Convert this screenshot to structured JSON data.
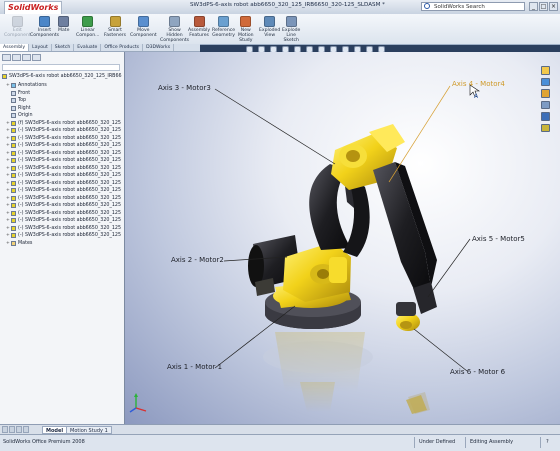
{
  "window": {
    "logo": "SolidWorks",
    "title": "SW3dPS-6-axis robot abb6650_320_125_IRB6650_320-125_SLDASM *",
    "search_placeholder": "SolidWorks Search",
    "controls": [
      "_",
      "□",
      "×"
    ]
  },
  "ribbon": {
    "buttons": [
      {
        "id": "edit-component",
        "label": "Edit\nComponent",
        "color": "#9fa9b8",
        "disabled": true
      },
      {
        "id": "insert-components",
        "label": "Insert\nComponents",
        "color": "#4b86c8"
      },
      {
        "id": "mate",
        "label": "Mate",
        "color": "#6e7fa0"
      },
      {
        "id": "linear-component",
        "label": "Linear\nCompon...",
        "color": "#3e9c4b"
      },
      {
        "id": "smart-fasteners",
        "label": "Smart\nFasteners",
        "color": "#c7a23a"
      },
      {
        "id": "move-component",
        "label": "Move\nComponent",
        "color": "#5a8fcf"
      },
      {
        "id": "show-hidden",
        "label": "Show\nHidden\nComponents",
        "color": "#8fa5c0"
      },
      {
        "id": "assembly-features",
        "label": "Assembly\nFeatures",
        "color": "#b85a3c"
      },
      {
        "id": "reference-geometry",
        "label": "Reference\nGeometry",
        "color": "#6aa0d0"
      },
      {
        "id": "new-motion-study",
        "label": "New\nMotion\nStudy",
        "color": "#d06a3a"
      },
      {
        "id": "exploded-view",
        "label": "Exploded\nView",
        "color": "#5f8ab8"
      },
      {
        "id": "explode-line-sketch",
        "label": "Explode\nLine\nSketch",
        "color": "#7b95b9"
      }
    ]
  },
  "command_tabs": [
    "Assembly",
    "Layout",
    "Sketch",
    "Evaluate",
    "Office Products",
    "D3DWorks"
  ],
  "feature_tree": {
    "root": "SW3dPS-6-axis robot abb6650_320_125_IRB66",
    "items": [
      {
        "label": "Annotations",
        "icon": "ann",
        "expand": "+"
      },
      {
        "label": "Front",
        "icon": "plane",
        "expand": ""
      },
      {
        "label": "Top",
        "icon": "plane",
        "expand": ""
      },
      {
        "label": "Right",
        "icon": "plane",
        "expand": ""
      },
      {
        "label": "Origin",
        "icon": "plane",
        "expand": ""
      },
      {
        "label": "(f) SW3dPS-6-axis robot abb6650_320_125",
        "icon": "part",
        "expand": "+"
      },
      {
        "label": "(-) SW3dPS-6-axis robot abb6650_320_125",
        "icon": "part",
        "expand": "+"
      },
      {
        "label": "(-) SW3dPS-6-axis robot abb6650_320_125",
        "icon": "part",
        "expand": "+"
      },
      {
        "label": "(-) SW3dPS-6-axis robot abb6650_320_125",
        "icon": "part",
        "expand": "+"
      },
      {
        "label": "(-) SW3dPS-6-axis robot abb6650_320_125",
        "icon": "part",
        "expand": "+"
      },
      {
        "label": "(-) SW3dPS-6-axis robot abb6650_320_125",
        "icon": "part",
        "expand": "+"
      },
      {
        "label": "(-) SW3dPS-6-axis robot abb6650_320_125",
        "icon": "part",
        "expand": "+"
      },
      {
        "label": "(-) SW3dPS-6-axis robot abb6650_320_125",
        "icon": "part",
        "expand": "+"
      },
      {
        "label": "(-) SW3dPS-6-axis robot abb6650_320_125",
        "icon": "part",
        "expand": "+"
      },
      {
        "label": "(-) SW3dPS-6-axis robot abb6650_320_125",
        "icon": "part",
        "expand": "+"
      },
      {
        "label": "(-) SW3dPS-6-axis robot abb6650_320_125",
        "icon": "part",
        "expand": "+"
      },
      {
        "label": "(-) SW3dPS-6-axis robot abb6650_320_125",
        "icon": "part",
        "expand": "+"
      },
      {
        "label": "(-) SW3dPS-6-axis robot abb6650_320_125",
        "icon": "part",
        "expand": "+"
      },
      {
        "label": "(-) SW3dPS-6-axis robot abb6650_320_125",
        "icon": "part",
        "expand": "+"
      },
      {
        "label": "(-) SW3dPS-6-axis robot abb6650_320_125",
        "icon": "part",
        "expand": "+"
      },
      {
        "label": "(-) SW3dPS-6-axis robot abb6650_320_125",
        "icon": "part",
        "expand": "+"
      },
      {
        "label": "Mates",
        "icon": "folder",
        "expand": "+"
      }
    ]
  },
  "callouts": {
    "axis1": "Axis 1 - Motor 1",
    "axis2": "Axis 2 - Motor2",
    "axis3": "Axis 3 - Motor3",
    "axis4": "Axis 4 - Motor4",
    "axis5": "Axis 5 - Motor5",
    "axis6": "Axis 6 - Motor 6"
  },
  "bottom_tabs": {
    "model": "Model",
    "motion_study": "Motion Study 1"
  },
  "status": {
    "product": "SolidWorks Office Premium 2008",
    "state": "Under Defined",
    "mode": "Editing Assembly"
  },
  "colors": {
    "robot_yellow": "#f2d21a",
    "robot_black": "#1e1e22",
    "axis4_line": "#d7a033"
  }
}
